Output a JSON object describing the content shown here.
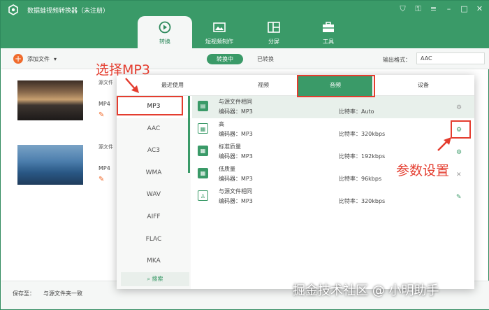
{
  "app": {
    "title": "数据蛙视频转换器（未注册）",
    "accent": "#3a9a68",
    "annot_color": "#e43d2f"
  },
  "nav": [
    {
      "label": "转换",
      "icon": "convert-icon"
    },
    {
      "label": "短视频制作",
      "icon": "short-video-icon"
    },
    {
      "label": "分屏",
      "icon": "split-screen-icon"
    },
    {
      "label": "工具",
      "icon": "toolbox-icon"
    }
  ],
  "toolbar": {
    "add_file": "添加文件",
    "subtabs": [
      "转换中",
      "已转换"
    ],
    "output_format_label": "输出格式：",
    "output_format_value": "AAC"
  },
  "files": [
    {
      "label": "源文件",
      "format": "MP4"
    },
    {
      "label": "源文件",
      "format": "MP4"
    }
  ],
  "save": {
    "label": "保存至：",
    "value": "与源文件夹一致"
  },
  "modal": {
    "tabs": [
      "最近使用",
      "视频",
      "音频",
      "设备"
    ],
    "formats": [
      "MP3",
      "AAC",
      "AC3",
      "WMA",
      "WAV",
      "AIFF",
      "FLAC",
      "MKA"
    ],
    "search_label": "搜索",
    "qualities": [
      {
        "name": "与源文件相同",
        "encoder": "编码器：MP3",
        "bitrate": "比特率：Auto",
        "icon": "doc-icon"
      },
      {
        "name": "高",
        "encoder": "编码器：MP3",
        "bitrate": "比特率：320kbps",
        "icon": "high-quality-icon"
      },
      {
        "name": "标准质量",
        "encoder": "编码器：MP3",
        "bitrate": "比特率：192kbps",
        "icon": "standard-quality-icon"
      },
      {
        "name": "低质量",
        "encoder": "编码器：MP3",
        "bitrate": "比特率：96kbps",
        "icon": "low-quality-icon"
      },
      {
        "name": "与源文件相同",
        "encoder": "编码器：MP3",
        "bitrate": "比特率：320kbps",
        "icon": "user-preset-icon"
      }
    ]
  },
  "annotations": {
    "select_mp3": "选择MP3",
    "param_settings": "参数设置"
  },
  "watermark": "掘金技术社区 @ 小明助手"
}
